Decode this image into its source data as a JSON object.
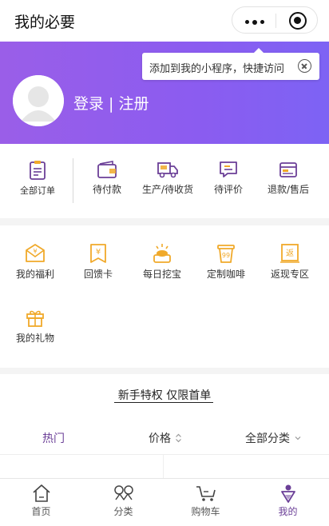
{
  "navbar": {
    "title": "我的必要"
  },
  "tooltip": {
    "text": "添加到我的小程序，快捷访问"
  },
  "profile": {
    "login_text": "登录 | 注册"
  },
  "orders": [
    {
      "label": "全部订单",
      "icon": "order-list-icon"
    },
    {
      "label": "待付款",
      "icon": "wallet-icon"
    },
    {
      "label": "生产/待收货",
      "icon": "truck-icon"
    },
    {
      "label": "待评价",
      "icon": "comment-icon"
    },
    {
      "label": "退款/售后",
      "icon": "refund-card-icon"
    }
  ],
  "services": [
    {
      "label": "我的福利",
      "icon": "welfare-envelope-icon"
    },
    {
      "label": "回馈卡",
      "icon": "yen-card-icon"
    },
    {
      "label": "每日挖宝",
      "icon": "treasure-icon"
    },
    {
      "label": "定制咖啡",
      "icon": "coffee-cup-icon"
    },
    {
      "label": "返现专区",
      "icon": "cashback-icon"
    },
    {
      "label": "我的礼物",
      "icon": "gift-icon"
    }
  ],
  "promo": {
    "title": "新手特权 仅限首单"
  },
  "filters": {
    "hot": "热门",
    "price": "价格",
    "category": "全部分类"
  },
  "tabs": [
    {
      "label": "首页",
      "icon": "home-icon"
    },
    {
      "label": "分类",
      "icon": "category-icon"
    },
    {
      "label": "购物车",
      "icon": "cart-icon"
    },
    {
      "label": "我的",
      "icon": "profile-icon"
    }
  ],
  "colors": {
    "brand": "#6b3f97",
    "header": "#8b5cf0",
    "service_gold": "#f0a92a"
  }
}
